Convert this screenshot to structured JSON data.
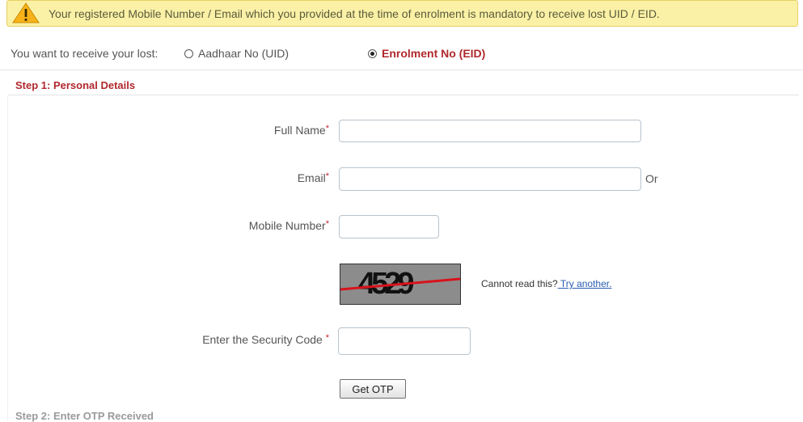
{
  "notice": {
    "icon": "warning-icon",
    "text": "Your registered Mobile Number / Email which you provided at the time of enrolment is mandatory to receive lost UID / EID."
  },
  "choice": {
    "label": "You want to receive your lost:",
    "options": [
      {
        "label": "Aadhaar No (UID)",
        "selected": false
      },
      {
        "label": "Enrolment No (EID)",
        "selected": true
      }
    ]
  },
  "step1": {
    "title": "Step 1: Personal Details",
    "full_name_label": "Full Name",
    "email_label": "Email",
    "or_text": "Or",
    "mobile_label": "Mobile Number",
    "required_marker": "*",
    "captcha_text": "4529",
    "cannot_read": "Cannot read this?",
    "try_another": " Try another.",
    "security_label": "Enter the Security Code ",
    "get_otp": "Get OTP"
  },
  "step2": {
    "title": "Step 2: Enter OTP Received"
  },
  "colors": {
    "accent": "#b0282d",
    "notice_bg": "#fbf1a6",
    "captcha_strike": "#d8121b"
  }
}
